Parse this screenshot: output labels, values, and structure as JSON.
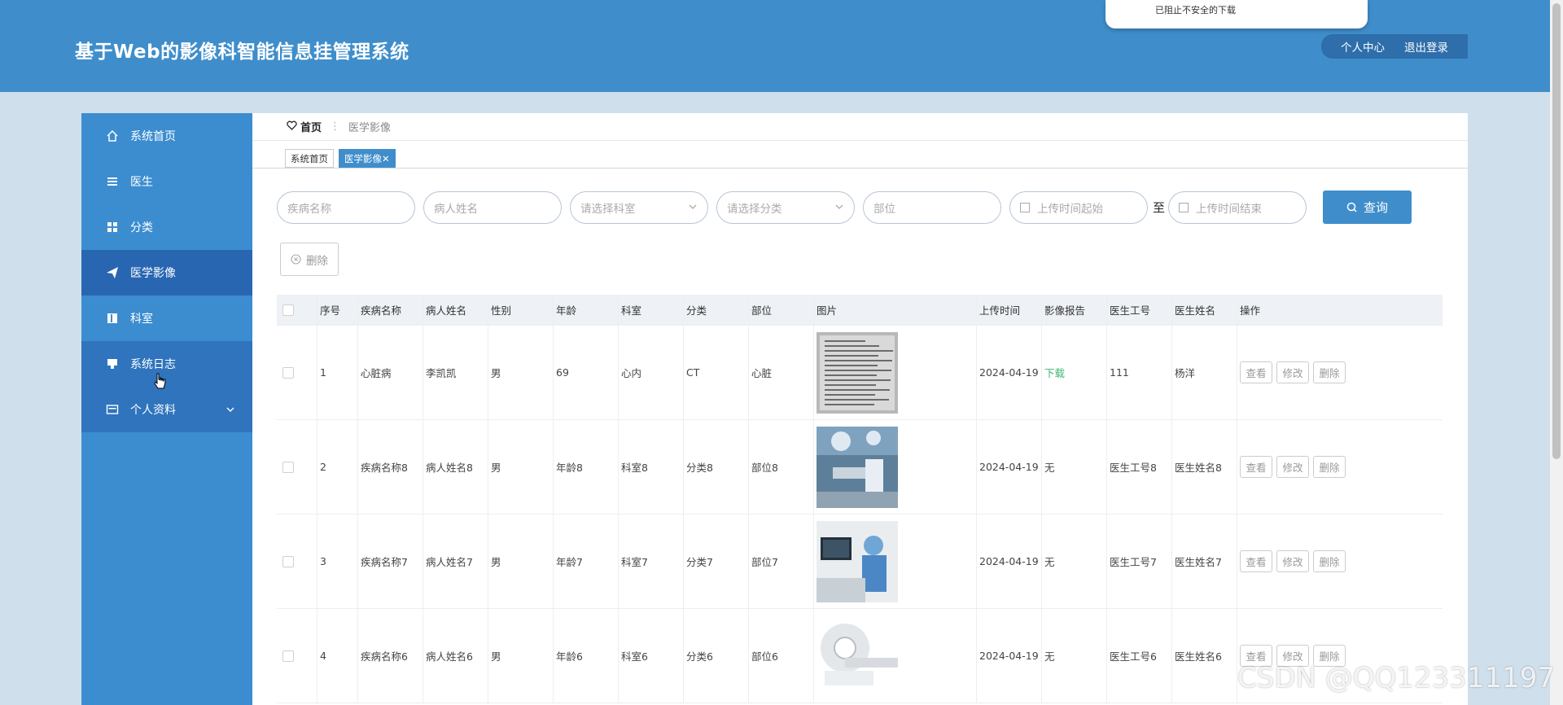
{
  "header": {
    "title": "基于Web的影像科智能信息挂管理系统",
    "personal_center": "个人中心",
    "logout": "退出登录",
    "download_notice": "已阻止不安全的下载"
  },
  "sidebar": {
    "items": [
      {
        "label": "系统首页",
        "icon": "home-icon"
      },
      {
        "label": "医生",
        "icon": "list-icon"
      },
      {
        "label": "分类",
        "icon": "grid-icon"
      },
      {
        "label": "医学影像",
        "icon": "send-icon"
      },
      {
        "label": "科室",
        "icon": "book-icon"
      },
      {
        "label": "系统日志",
        "icon": "monitor-icon"
      },
      {
        "label": "个人资料",
        "icon": "id-card-icon"
      }
    ]
  },
  "breadcrumb": {
    "home": "首页",
    "current": "医学影像"
  },
  "tabs": [
    {
      "label": "系统首页"
    },
    {
      "label": "医学影像✕"
    }
  ],
  "filters": {
    "disease": "疾病名称",
    "patient": "病人姓名",
    "department": "请选择科室",
    "category": "请选择分类",
    "part": "部位",
    "time_start": "上传时间起始",
    "to": "至",
    "time_end": "上传时间结束",
    "query": "查询"
  },
  "actions": {
    "delete": "删除"
  },
  "table": {
    "columns": [
      "序号",
      "疾病名称",
      "病人姓名",
      "性别",
      "年龄",
      "科室",
      "分类",
      "部位",
      "图片",
      "上传时间",
      "影像报告",
      "医生工号",
      "医生姓名",
      "操作"
    ],
    "rows": [
      {
        "no": "1",
        "disease": "心脏病",
        "patient": "李凯凯",
        "gender": "男",
        "age": "69",
        "dept": "心内",
        "category": "CT",
        "part": "心脏",
        "image": "document-scan",
        "time": "2024-04-19",
        "report": "下载",
        "doc_id": "111",
        "doc_name": "杨洋"
      },
      {
        "no": "2",
        "disease": "疾病名称8",
        "patient": "病人姓名8",
        "gender": "男",
        "age": "年龄8",
        "dept": "科室8",
        "category": "分类8",
        "part": "部位8",
        "image": "operating-room",
        "time": "2024-04-19",
        "report": "无",
        "doc_id": "医生工号8",
        "doc_name": "医生姓名8"
      },
      {
        "no": "3",
        "disease": "疾病名称7",
        "patient": "病人姓名7",
        "gender": "男",
        "age": "年龄7",
        "dept": "科室7",
        "category": "分类7",
        "part": "部位7",
        "image": "doctor-at-monitor",
        "time": "2024-04-19",
        "report": "无",
        "doc_id": "医生工号7",
        "doc_name": "医生姓名7"
      },
      {
        "no": "4",
        "disease": "疾病名称6",
        "patient": "病人姓名6",
        "gender": "男",
        "age": "年龄6",
        "dept": "科室6",
        "category": "分类6",
        "part": "部位6",
        "image": "ct-scanner",
        "time": "2024-04-19",
        "report": "无",
        "doc_id": "医生工号6",
        "doc_name": "医生姓名6"
      }
    ],
    "row_actions": {
      "view": "查看",
      "edit": "修改",
      "delete": "删除"
    }
  },
  "watermark": "CSDN @QQ123311197",
  "colors": {
    "header": "#3f8ecb",
    "sidebar": "#3c8dd0",
    "sidebar_active": "#2966b2",
    "report_link": "#3cb371"
  }
}
